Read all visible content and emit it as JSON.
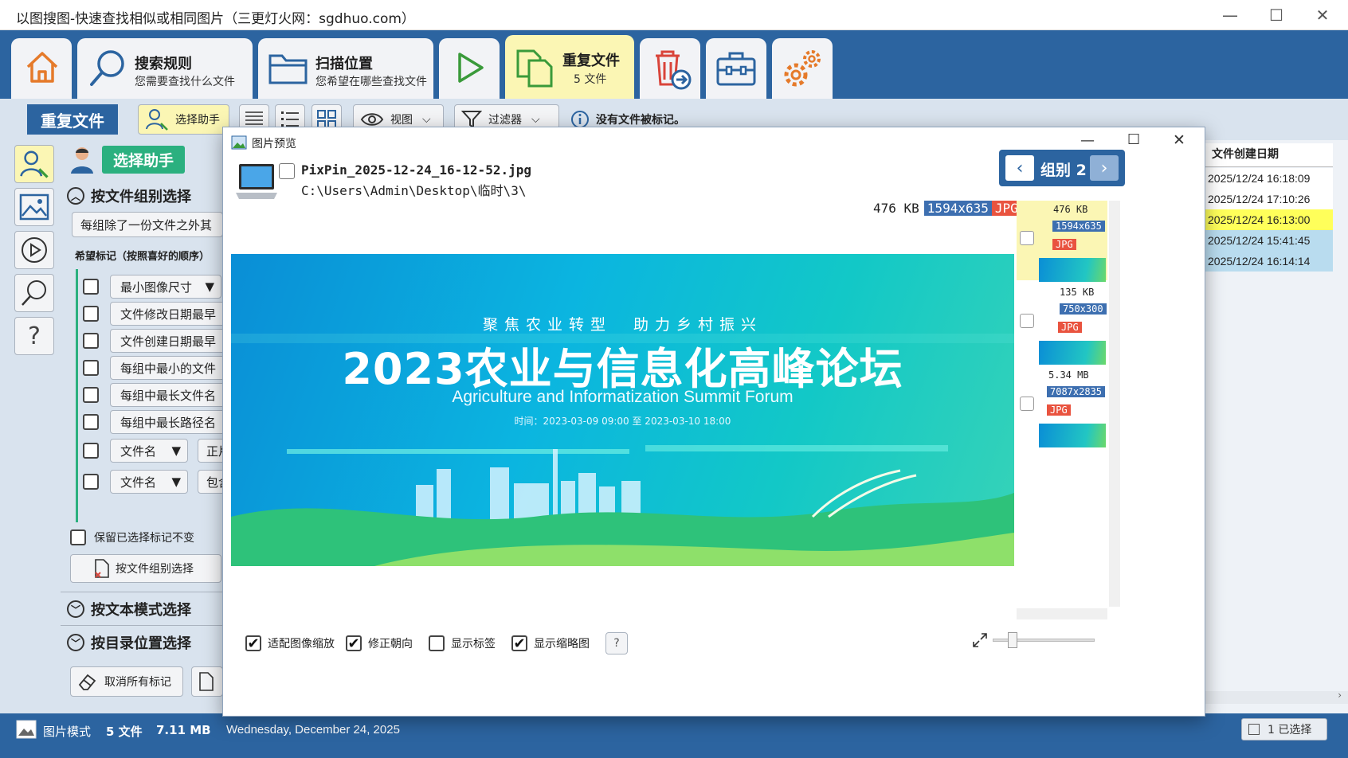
{
  "window": {
    "title": "以图搜图-快速查找相似或相同图片（三更灯火网：sgdhuo.com）",
    "minimize": "—",
    "maximize": "☐",
    "close": "✕"
  },
  "ribbon": {
    "search_rules": {
      "title": "搜索规则",
      "subtitle": "您需要查找什么文件"
    },
    "scan_location": {
      "title": "扫描位置",
      "subtitle": "您希望在哪些查找文件"
    },
    "duplicates": {
      "title": "重复文件",
      "subtitle": "5 文件"
    }
  },
  "subbar": {
    "section_title": "重复文件",
    "select_helper": "选择助手",
    "view": "视图",
    "filter": "过滤器",
    "status": "没有文件被标记。"
  },
  "left_panel": {
    "header": "选择助手",
    "group_select": "按文件组别选择",
    "group_mode": "每组除了一份文件之外其",
    "prefs_label": "希望标记（按照喜好的顺序）",
    "criteria": [
      "最小图像尺寸",
      "文件修改日期最早",
      "文件创建日期最早",
      "每组中最小的文件",
      "每组中最长文件名",
      "每组中最长路径名",
      "文件名",
      "文件名"
    ],
    "criteria_extra": [
      "正片",
      "包含"
    ],
    "keep_selection": "保留已选择标记不变",
    "apply_group": "按文件组别选择",
    "text_pattern": "按文本模式选择",
    "dir_location": "按目录位置选择",
    "clear_marks": "取消所有标记"
  },
  "right_panel": {
    "column_header": "文件创建日期",
    "dates": [
      "2025/12/24 16:18:09",
      "2025/12/24 17:10:26",
      "2025/12/24 16:13:00",
      "2025/12/24 15:41:45",
      "2025/12/24 16:14:14"
    ],
    "row_colors": [
      "#ffffff",
      "#ffffff",
      "#ffff5a",
      "#b9dcef",
      "#b9dcef"
    ],
    "selected_badge": "1 已选择"
  },
  "dialog": {
    "title": "图片预览",
    "filename": "PixPin_2025-12-24_16-12-52.jpg",
    "path": "C:\\Users\\Admin\\Desktop\\临时\\3\\",
    "group_label": "组别 2",
    "size": "476 KB",
    "dimensions": "1594x635",
    "type": "JPG",
    "banner": {
      "subtitle": "聚焦农业转型　助力乡村振兴",
      "title": "2023农业与信息化高峰论坛",
      "english": "Agriculture and Informatization Summit Forum",
      "time": "时间：2023-03-09 09:00 至 2023-03-10 18:00"
    },
    "thumbs": [
      {
        "size": "476 KB",
        "dims": "1594x635",
        "type": "JPG"
      },
      {
        "size": "135 KB",
        "dims": "750x300",
        "type": "JPG"
      },
      {
        "size": "5.34 MB",
        "dims": "7087x2835",
        "type": "JPG"
      }
    ],
    "options": {
      "fit": "适配图像缩放",
      "orient": "修正朝向",
      "labels": "显示标签",
      "thumbs": "显示缩略图",
      "help": "?"
    }
  },
  "status": {
    "mode": "图片模式",
    "count": "5 文件",
    "size": "7.11 MB",
    "date": "Wednesday, December 24, 2025"
  },
  "colors": {
    "accent": "#2c64a0",
    "selected_row": "#ffff5a",
    "highlight": "#fbf6b4"
  }
}
